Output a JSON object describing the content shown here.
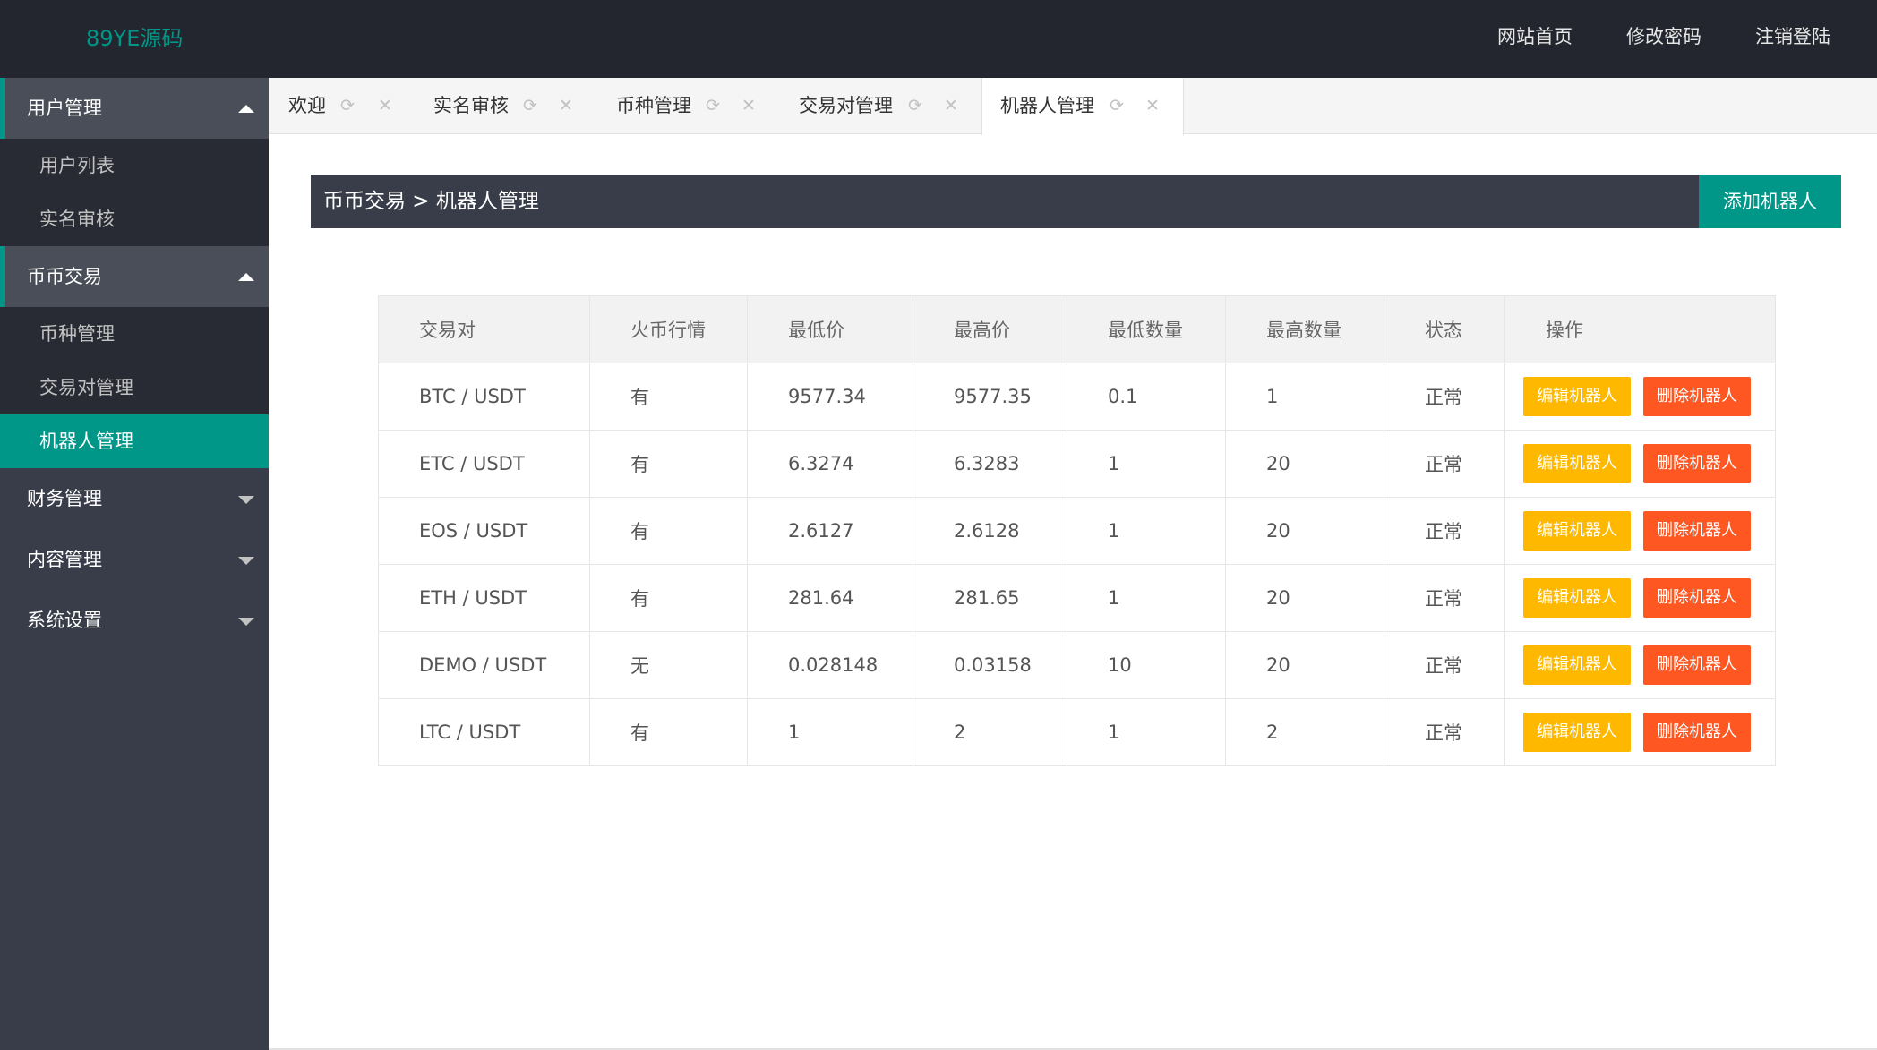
{
  "header": {
    "logo": "89YE源码",
    "nav": [
      "网站首页",
      "修改密码",
      "注销登陆"
    ]
  },
  "sidebar": {
    "groups": [
      {
        "label": "用户管理",
        "expanded": true,
        "children": [
          "用户列表",
          "实名审核"
        ]
      },
      {
        "label": "币币交易",
        "expanded": true,
        "children": [
          "币种管理",
          "交易对管理",
          "机器人管理"
        ]
      },
      {
        "label": "财务管理",
        "expanded": false,
        "children": []
      },
      {
        "label": "内容管理",
        "expanded": false,
        "children": []
      },
      {
        "label": "系统设置",
        "expanded": false,
        "children": []
      }
    ],
    "active_item": "机器人管理"
  },
  "tabs": [
    {
      "label": "欢迎",
      "refresh": "⟳",
      "close": "✕"
    },
    {
      "label": "实名审核",
      "refresh": "⟳",
      "close": "✕"
    },
    {
      "label": "币种管理",
      "refresh": "⟳",
      "close": "✕"
    },
    {
      "label": "交易对管理",
      "refresh": "⟳",
      "close": "✕"
    },
    {
      "label": "机器人管理",
      "refresh": "⟳",
      "close": "✕"
    }
  ],
  "active_tab": "机器人管理",
  "panel": {
    "breadcrumb": "币币交易 > 机器人管理",
    "add_button": "添加机器人"
  },
  "table": {
    "headers": [
      "交易对",
      "火币行情",
      "最低价",
      "最高价",
      "最低数量",
      "最高数量",
      "状态",
      "操作"
    ],
    "rows": [
      [
        "BTC / USDT",
        "有",
        "9577.34",
        "9577.35",
        "0.1",
        "1",
        "正常"
      ],
      [
        "ETC / USDT",
        "有",
        "6.3274",
        "6.3283",
        "1",
        "20",
        "正常"
      ],
      [
        "EOS / USDT",
        "有",
        "2.6127",
        "2.6128",
        "1",
        "20",
        "正常"
      ],
      [
        "ETH / USDT",
        "有",
        "281.64",
        "281.65",
        "1",
        "20",
        "正常"
      ],
      [
        "DEMO / USDT",
        "无",
        "0.028148",
        "0.03158",
        "10",
        "20",
        "正常"
      ],
      [
        "LTC / USDT",
        "有",
        "1",
        "2",
        "1",
        "2",
        "正常"
      ]
    ],
    "edit_label": "编辑机器人",
    "delete_label": "删除机器人"
  },
  "colors": {
    "header_bg": "#23262e",
    "sidebar_bg": "#393d49",
    "accent": "#009688",
    "edit_btn": "#ffb800",
    "delete_btn": "#ff5722"
  }
}
